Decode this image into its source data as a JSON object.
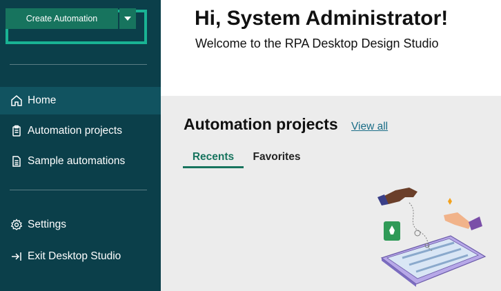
{
  "sidebar": {
    "create_button_label": "Create Automation",
    "items": [
      {
        "label": "Home",
        "icon": "home-icon"
      },
      {
        "label": "Automation projects",
        "icon": "clipboard-icon"
      },
      {
        "label": "Sample automations",
        "icon": "document-icon"
      },
      {
        "label": "Settings",
        "icon": "gear-icon"
      },
      {
        "label": "Exit Desktop Studio",
        "icon": "exit-icon"
      }
    ]
  },
  "header": {
    "title": "Hi, System Administrator!",
    "subtitle": "Welcome to the RPA Desktop Design Studio"
  },
  "main": {
    "section_title": "Automation projects",
    "view_all_label": "View all",
    "tabs": [
      {
        "label": "Recents"
      },
      {
        "label": "Favorites"
      }
    ]
  },
  "colors": {
    "sidebar_bg": "#0b3f4a",
    "accent": "#17745e",
    "highlight_border": "#19b394",
    "link": "#1a6d87"
  }
}
